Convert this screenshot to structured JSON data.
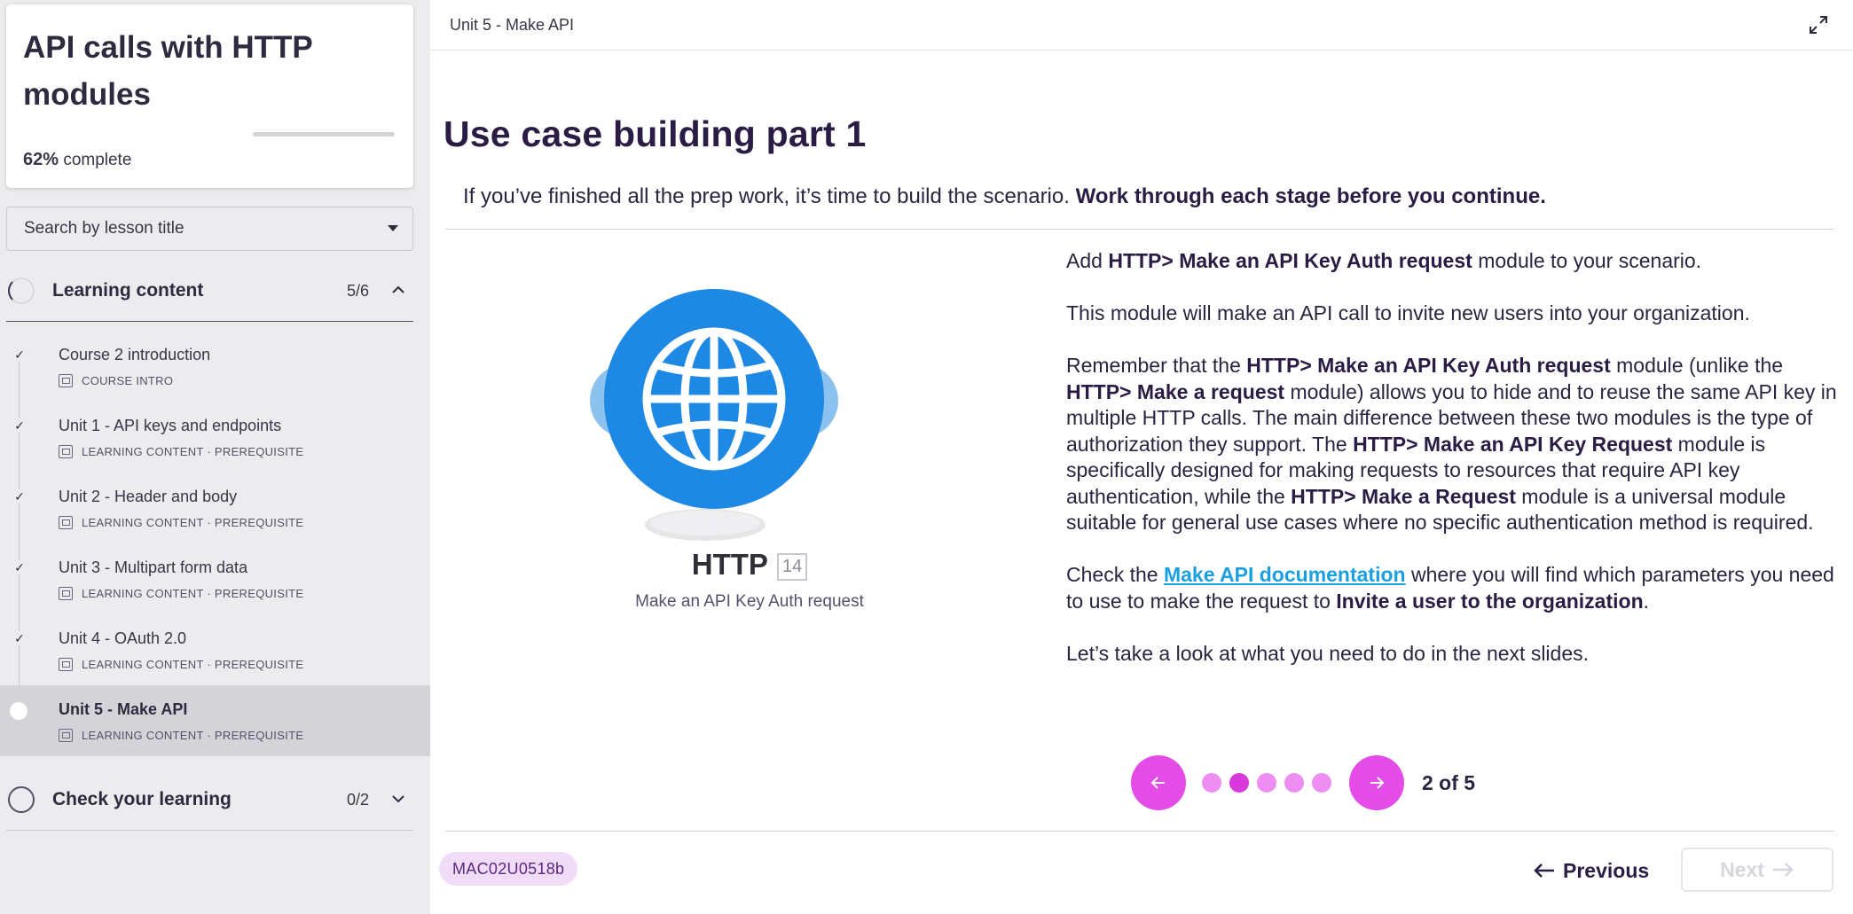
{
  "sidebar": {
    "course_title": "API calls with HTTP modules",
    "progress_percent": "62%",
    "progress_suffix": "complete",
    "progress_value": 0.62,
    "search": {
      "label": "Search by lesson title"
    },
    "sections": [
      {
        "label": "Learning content",
        "count": "5/6",
        "expanded": true
      },
      {
        "label": "Check your learning",
        "count": "0/2",
        "expanded": false
      }
    ],
    "lessons": [
      {
        "title": "Course 2 introduction",
        "meta": "COURSE INTRO",
        "done": true
      },
      {
        "title": "Unit 1 - API keys and endpoints",
        "meta": "LEARNING CONTENT · PREREQUISITE",
        "done": true
      },
      {
        "title": "Unit 2 - Header and body",
        "meta": "LEARNING CONTENT · PREREQUISITE",
        "done": true
      },
      {
        "title": "Unit 3 - Multipart form data",
        "meta": "LEARNING CONTENT · PREREQUISITE",
        "done": true
      },
      {
        "title": "Unit 4 - OAuth 2.0",
        "meta": "LEARNING CONTENT · PREREQUISITE",
        "done": true
      },
      {
        "title": "Unit 5 - Make API",
        "meta": "LEARNING CONTENT · PREREQUISITE",
        "done": false,
        "active": true
      }
    ]
  },
  "main": {
    "breadcrumb": "Unit 5 - Make API",
    "title": "Use case building part 1",
    "intro_plain": "If you’ve finished all the prep work, it’s time to build the scenario. ",
    "intro_bold": "Work through each stage before you continue.",
    "http_module": {
      "name": "HTTP",
      "badge": "14",
      "caption": "Make an API Key Auth request",
      "icon": "globe-icon",
      "color": "#1e88e5"
    },
    "paragraphs": {
      "p1_a": "Add ",
      "p1_b": "HTTP> Make an API Key Auth request",
      "p1_c": " module to your scenario.",
      "p2": "This module will make an API call to invite new users into your organization.",
      "p3_a": "Remember that the ",
      "p3_b": "HTTP> Make an API Key Auth request",
      "p3_c": " module (unlike the ",
      "p3_d": "HTTP> Make a request",
      "p3_e": " module) allows you to hide and to reuse the same API key in multiple HTTP calls. The main difference between these two modules is the type of authorization they support. The ",
      "p3_f": "HTTP> Make an API Key Request",
      "p3_g": " module is specifically designed for making requests to resources that require API key authentication, while the ",
      "p3_h": "HTTP> Make a Request",
      "p3_i": " module is a universal module suitable for general use cases where no specific authentication method is required.",
      "p4_a": "Check the ",
      "p4_link": "Make API documentation",
      "p4_b": " where you will find which parameters you need to use to make the request to ",
      "p4_c": "Invite a user to the organization",
      "p4_d": ".",
      "p5": "Let’s take a look at what you need to do in the next slides."
    },
    "carousel": {
      "current_index": 2,
      "total": 5,
      "counter": "2 of 5"
    },
    "footer": {
      "code": "MAC02U0518b",
      "prev_label": "Previous",
      "next_label": "Next"
    }
  },
  "colors": {
    "accent_pink": "#e44ce8",
    "dot_inactive": "#ef8ef2",
    "link": "#1aa0e0",
    "title_dark": "#2a1c44"
  }
}
